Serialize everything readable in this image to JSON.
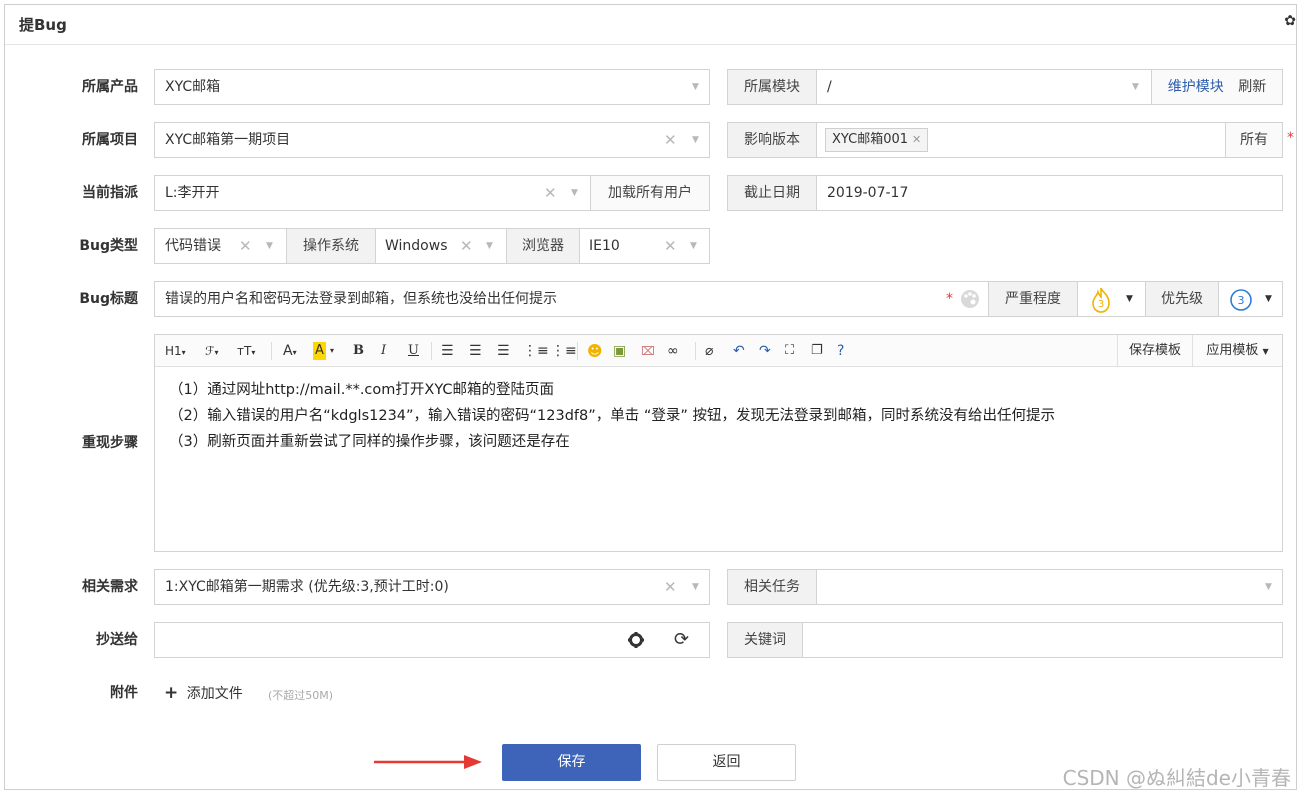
{
  "window": {
    "title": "提Bug"
  },
  "form": {
    "product": {
      "label": "所属产品",
      "value": "XYC邮箱"
    },
    "module": {
      "label": "所属模块",
      "value": "/",
      "maintain": "维护模块",
      "refresh": "刷新"
    },
    "project": {
      "label": "所属项目",
      "value": "XYC邮箱第一期项目"
    },
    "build": {
      "label": "影响版本",
      "tag": "XYC邮箱001",
      "all": "所有"
    },
    "assignee": {
      "label": "当前指派",
      "value": "L:李开开",
      "load_all": "加载所有用户"
    },
    "deadline": {
      "label": "截止日期",
      "value": "2019-07-17"
    },
    "bug_type": {
      "label": "Bug类型",
      "value": "代码错误"
    },
    "os": {
      "label": "操作系统",
      "value": "Windows"
    },
    "browser": {
      "label": "浏览器",
      "value": "IE10"
    },
    "bug_title": {
      "label": "Bug标题",
      "value": "错误的用户名和密码无法登录到邮箱，但系统也没给出任何提示"
    },
    "severity": {
      "label": "严重程度",
      "value": "3"
    },
    "priority": {
      "label": "优先级",
      "value": "3"
    },
    "steps": {
      "label": "重现步骤",
      "lines": [
        "（1）通过网址http://mail.**.com打开XYC邮箱的登陆页面",
        "（2）输入错误的用户名“kdgls1234”，输入错误的密码“123df8”，单击 “登录” 按钮，发现无法登录到邮箱，同时系统没有给出任何提示",
        "（3）刷新页面并重新尝试了同样的操作步骤，该问题还是存在"
      ],
      "toolbar": {
        "heading": "H1",
        "font": "ℱ",
        "size": "тT",
        "save_template": "保存模板",
        "apply_template": "应用模板"
      }
    },
    "story": {
      "label": "相关需求",
      "value": "1:XYC邮箱第一期需求 (优先级:3,预计工时:0)"
    },
    "task": {
      "label": "相关任务",
      "value": ""
    },
    "mailto": {
      "label": "抄送给",
      "value": ""
    },
    "keywords": {
      "label": "关键词",
      "value": ""
    },
    "attachment": {
      "label": "附件",
      "add": "添加文件",
      "hint": "(不超过50M)"
    }
  },
  "buttons": {
    "save": "保存",
    "back": "返回"
  },
  "watermark": "CSDN @ぬ糾結de小青春",
  "colors": {
    "primary": "#3d64b8",
    "link": "#2f5eae",
    "required": "#e53935",
    "arrow": "#e53935",
    "severity_icon": "#f0b400",
    "priority_icon": "#2f7bd6"
  }
}
